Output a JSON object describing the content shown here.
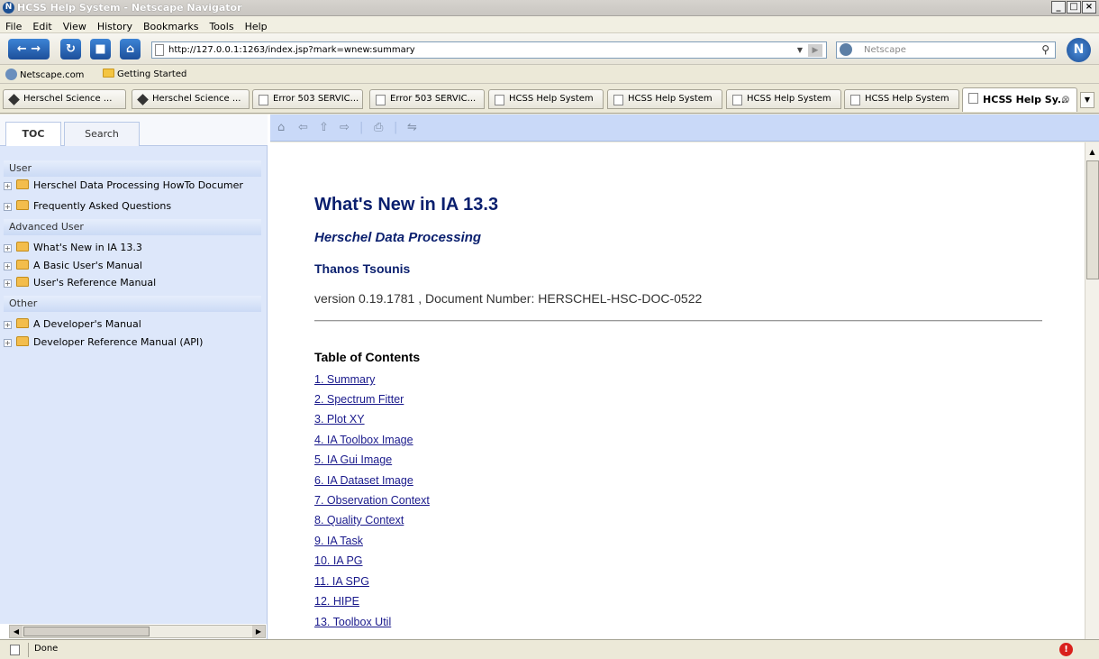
{
  "window": {
    "title": "HCSS Help System - Netscape Navigator",
    "controls": {
      "minimize": "_",
      "maximize": "□",
      "close": "×"
    }
  },
  "menu": [
    "File",
    "Edit",
    "View",
    "History",
    "Bookmarks",
    "Tools",
    "Help"
  ],
  "nav": {
    "url": "http://127.0.0.1:1263/index.jsp?mark=wnew:summary",
    "search_placeholder": "Netscape"
  },
  "bookmarks": [
    "Netscape.com",
    "Getting Started"
  ],
  "tabs": [
    {
      "label": "Herschel Science ...",
      "icon": "diamond-icon"
    },
    {
      "label": "Herschel Science ...",
      "icon": "diamond-icon"
    },
    {
      "label": "Error 503 SERVIC...",
      "icon": "page-icon"
    },
    {
      "label": "Error 503 SERVIC...",
      "icon": "page-icon"
    },
    {
      "label": "HCSS Help System",
      "icon": "page-icon"
    },
    {
      "label": "HCSS Help System",
      "icon": "page-icon"
    },
    {
      "label": "HCSS Help System",
      "icon": "page-icon"
    },
    {
      "label": "HCSS Help System",
      "icon": "page-icon"
    },
    {
      "label": "HCSS Help Sy...",
      "icon": "page-icon",
      "active": true
    }
  ],
  "leftpane": {
    "tabs": [
      "TOC",
      "Search"
    ],
    "sections": [
      {
        "title": "User",
        "items": [
          "Herschel Data Processing HowTo Documer",
          "Frequently Asked Questions"
        ]
      },
      {
        "title": "Advanced User",
        "items": [
          "What's New in IA 13.3",
          "A Basic User's Manual",
          "User's Reference Manual"
        ]
      },
      {
        "title": "Other",
        "items": [
          "A Developer's Manual",
          "Developer Reference Manual (API)"
        ]
      }
    ]
  },
  "document": {
    "title": "What's New in IA 13.3",
    "subtitle": "Herschel Data Processing",
    "author": "Thanos Tsounis",
    "version": "version 0.19.1781 , Document Number: HERSCHEL-HSC-DOC-0522",
    "toc_heading": "Table of Contents",
    "toc": [
      "1. Summary",
      "2. Spectrum Fitter",
      "3. Plot XY",
      "4. IA Toolbox Image",
      "5. IA Gui Image",
      "6. IA Dataset Image",
      "7. Observation Context",
      "8. Quality Context",
      "9. IA Task",
      "10. IA PG",
      "11. IA SPG",
      "12. HIPE",
      "13. Toolbox Util"
    ]
  },
  "status": {
    "text": "Done"
  },
  "colors": {
    "accent": "#c9d9f8",
    "doc_title": "#0a1f6e",
    "link": "#1a1a8c",
    "toc_bg": "#dde7fa"
  }
}
